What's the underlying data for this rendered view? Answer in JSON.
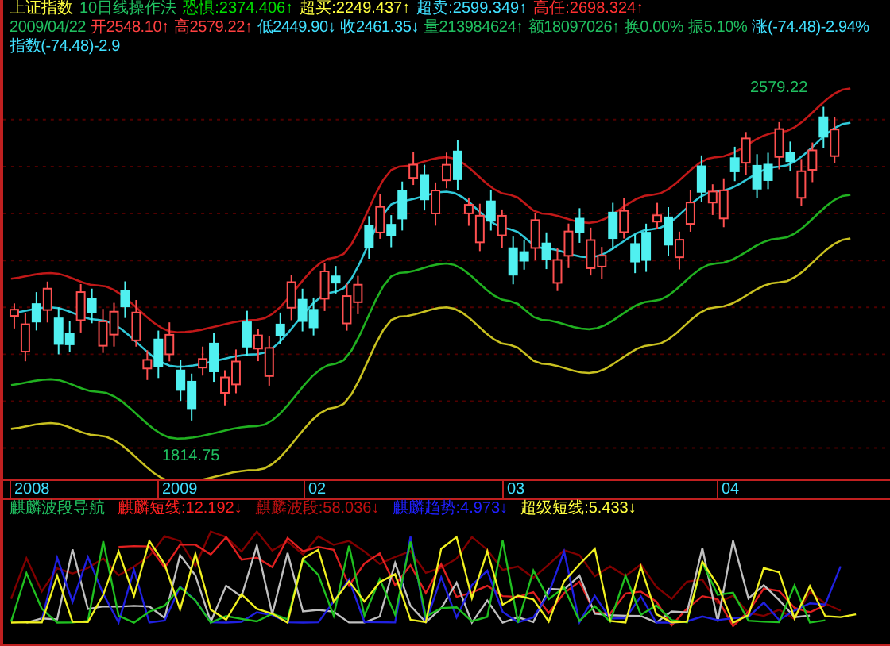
{
  "header": {
    "symbol": "上证指数",
    "method": "10日线操作法",
    "row_1": [
      {
        "text": "恐惧:2374.406↑",
        "color": "#00e000"
      },
      {
        "text": "超买:2249.437↑",
        "color": "#ffff40"
      },
      {
        "text": "超卖:2599.349↑",
        "color": "#40e0ff"
      },
      {
        "text": "高任:2698.324↑",
        "color": "#ff3030"
      }
    ],
    "row_2": [
      {
        "text": "2009/04/22",
        "color": "#20c060"
      },
      {
        "text": "开2548.10↑",
        "color": "#ff4040"
      },
      {
        "text": "高2579.22↑",
        "color": "#ff4040"
      },
      {
        "text": "低2449.90↓",
        "color": "#40e0ff"
      },
      {
        "text": "收2461.35↓",
        "color": "#40e0ff"
      },
      {
        "text": "量213984624↑",
        "color": "#20c060"
      },
      {
        "text": "额18097026↑",
        "color": "#20c060"
      },
      {
        "text": "换0.00%",
        "color": "#20c060"
      },
      {
        "text": "振5.10%",
        "color": "#20c060"
      },
      {
        "text": "涨(-74.48)-2.94%",
        "color": "#40e0ff"
      },
      {
        "text": "指数(-74.48)-2.9",
        "color": "#40e0ff"
      }
    ]
  },
  "chart": {
    "high_label": "2579.22",
    "low_label": "1814.75"
  },
  "time_axis": [
    "2008",
    "2009",
    "02",
    "03",
    "04"
  ],
  "indicator": {
    "title": "麒麟波段导航",
    "lines": [
      {
        "text": "麒麟短线:12.192↓",
        "color": "#ff2020"
      },
      {
        "text": "麒麟波段:58.036↓",
        "color": "#c01010"
      },
      {
        "text": "麒麟趋势:4.973↓",
        "color": "#2020ff"
      },
      {
        "text": "超级短线:5.433↓",
        "color": "#ffff40"
      }
    ]
  }
}
